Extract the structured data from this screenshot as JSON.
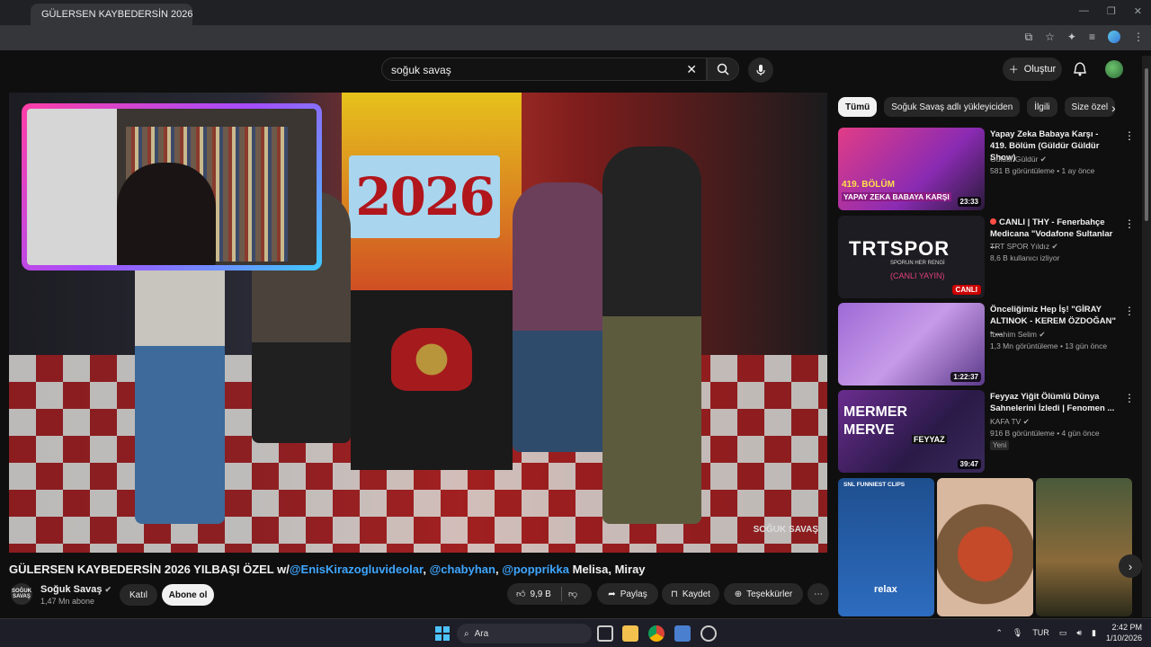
{
  "browser": {
    "tab_title": "GÜLERSEN KAYBEDERSİN 2026",
    "window_controls": [
      "—",
      "❐",
      "✕"
    ]
  },
  "header": {
    "search_value": "soğuk savaş",
    "create_label": "Oluştur"
  },
  "video": {
    "banner_text": "2026",
    "watermark": "SOĞUK SAVAŞ",
    "title_prefix": "GÜLERSEN KAYBEDERSİN 2026 YILBAŞI ÖZEL w/",
    "title_link1": "@EnisKirazogluvideolar",
    "title_sep1": ", ",
    "title_link2": "@chabyhan",
    "title_sep2": ", ",
    "title_link3": "@poppríkka",
    "title_suffix": " Melisa, Miray",
    "channel_name": "Soğuk Savaş",
    "channel_avatar_text": "SOĞUK SAVAŞ",
    "subscribers": "1,47 Mn abone",
    "join_label": "Katıl",
    "subscribe_label": "Abone ol",
    "likes": "9,9 B",
    "share_label": "Paylaş",
    "save_label": "Kaydet",
    "thanks_label": "Teşekkürler"
  },
  "chips": [
    "Tümü",
    "Soğuk Savaş adlı yükleyiciden",
    "İlgili",
    "Size özel"
  ],
  "recommendations": [
    {
      "title": "Yapay Zeka Babaya Karşı - 419. Bölüm (Güldür Güldür Show)",
      "channel": "Güldür Güldür",
      "meta": "581 B görüntüleme • 1 ay önce",
      "duration": "23:33",
      "thumb_text": "YAPAY ZEKA BABAYA KARŞI",
      "thumb_tag": "419. BÖLÜM"
    },
    {
      "title": "CANLI | THY - Fenerbahçe Medicana \"Vodafone Sultanlar ...",
      "channel": "TRT SPOR Yıldız",
      "meta": "8,6 B kullanıcı izliyor",
      "live_label": "CANLI",
      "thumb_logo": "TRTSPOR",
      "thumb_sub": "SPORUN HER RENGİ",
      "thumb_live": "(CANLI YAYIN)"
    },
    {
      "title": "Önceliğimiz Hep İş! \"GİRAY ALTINOK - KEREM ÖZDOĞAN\" - ...",
      "channel": "İbrahim Selim",
      "meta": "1,3 Mn görüntüleme • 13 gün önce",
      "duration": "1:22:37"
    },
    {
      "title": "Feyyaz Yiğit Ölümlü Dünya Sahnelerini İzledi | Fenomen ...",
      "channel": "KAFA TV",
      "meta": "916 B görüntüleme • 4 gün önce",
      "badge": "Yeni",
      "duration": "39:47",
      "thumb_text1": "MERMER",
      "thumb_text2": "MERVE",
      "thumb_text3": "FEYYAZ"
    }
  ],
  "shorts": {
    "first_caption": "SNL FUNNIEST CLIPS",
    "first_word": "relax"
  },
  "taskbar": {
    "search_label": "Ara",
    "language": "TUR",
    "time": "2:42 PM",
    "date": "1/10/2026"
  },
  "colors": {
    "accent_link": "#3ea6ff",
    "live_red": "#cc0000",
    "webcam_gradient": [
      "#ff3ea5",
      "#a44dff",
      "#3ec8ff"
    ]
  }
}
